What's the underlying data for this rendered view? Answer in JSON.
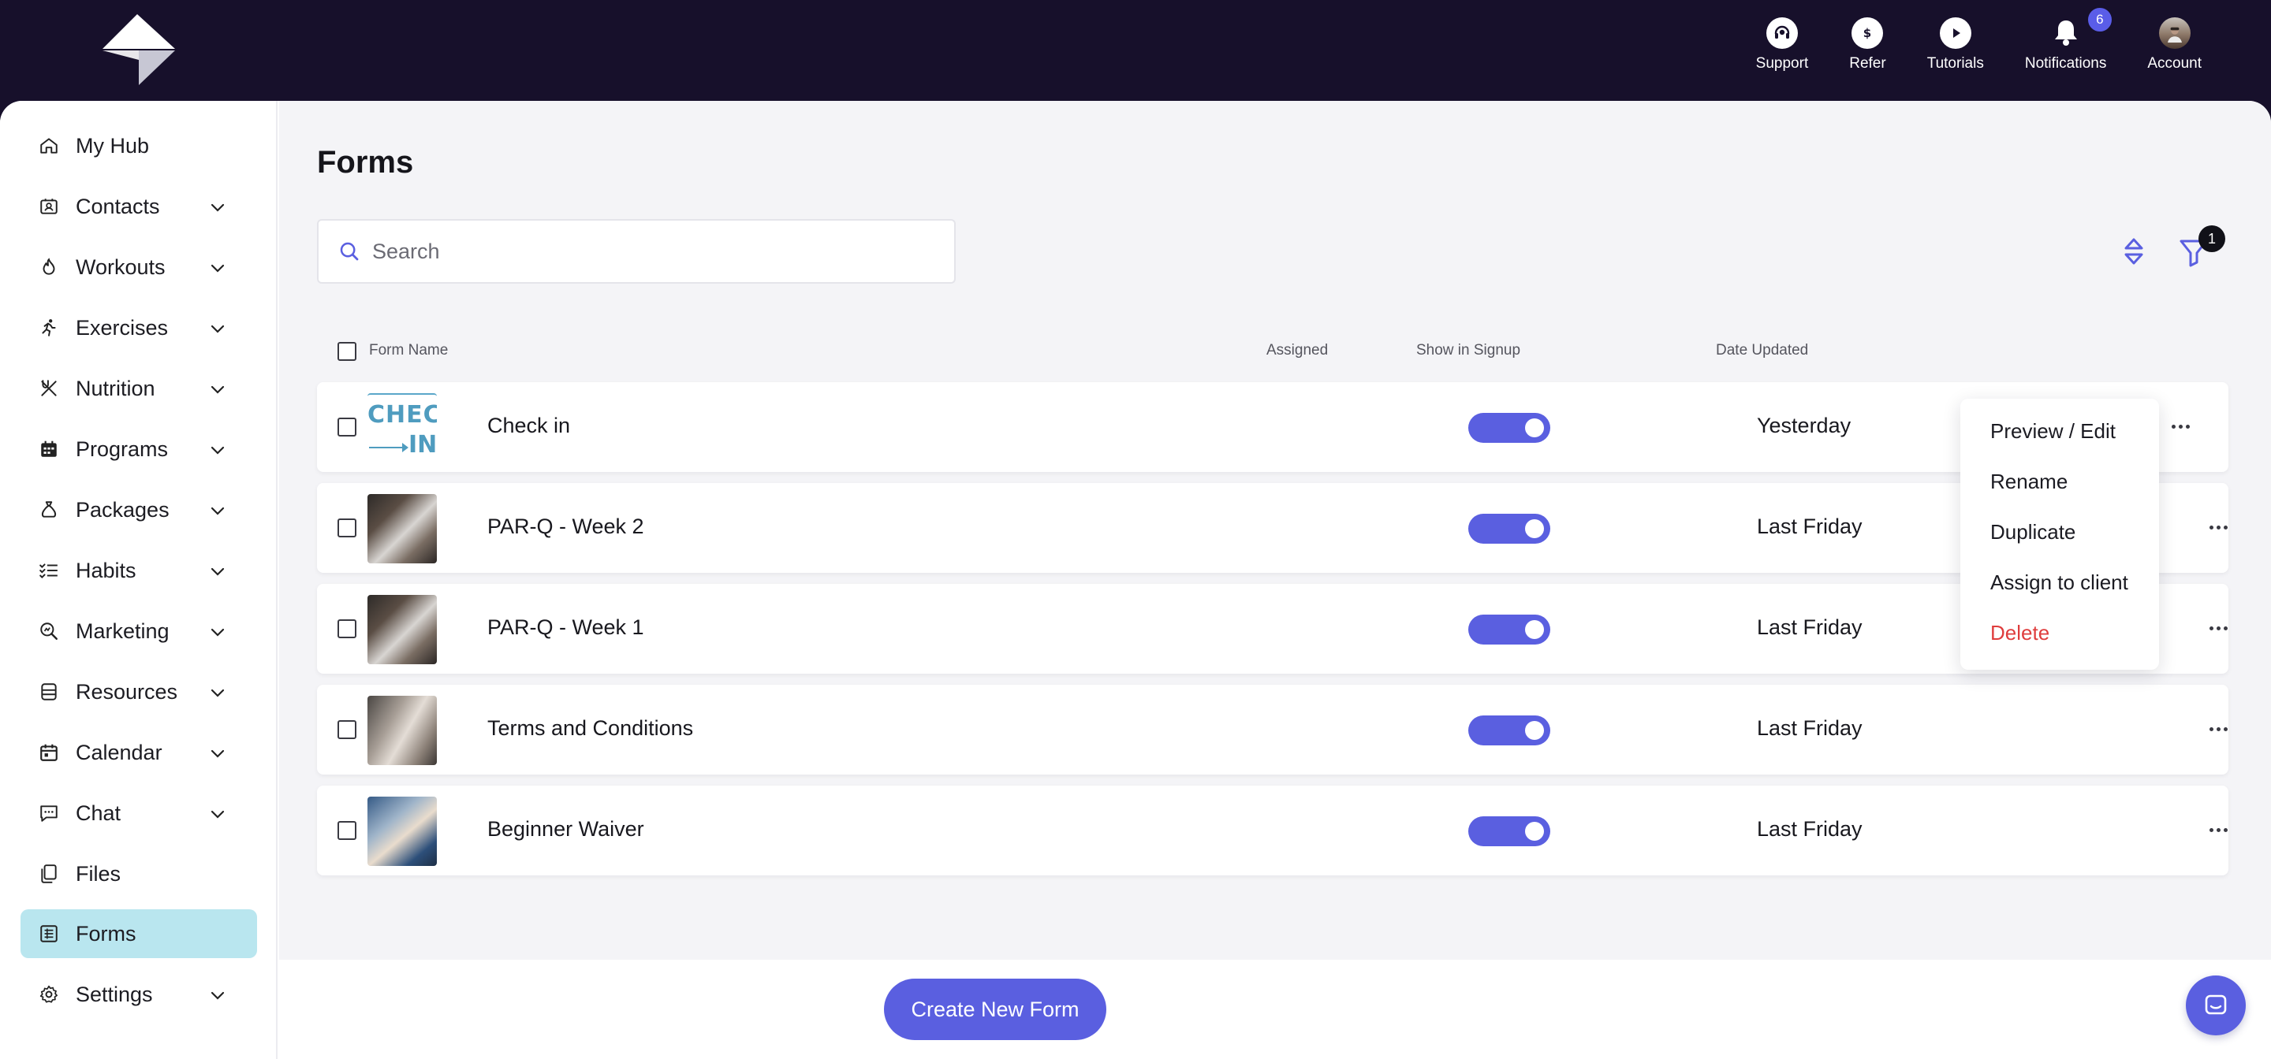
{
  "topnav": {
    "support": "Support",
    "refer": "Refer",
    "tutorials": "Tutorials",
    "notifications": "Notifications",
    "notifications_count": "6",
    "account": "Account"
  },
  "sidebar": {
    "items": [
      {
        "label": "My Hub",
        "icon": "home-icon",
        "expandable": false
      },
      {
        "label": "Contacts",
        "icon": "contacts-icon",
        "expandable": true
      },
      {
        "label": "Workouts",
        "icon": "workouts-icon",
        "expandable": true
      },
      {
        "label": "Exercises",
        "icon": "exercises-icon",
        "expandable": true
      },
      {
        "label": "Nutrition",
        "icon": "nutrition-icon",
        "expandable": true
      },
      {
        "label": "Programs",
        "icon": "programs-icon",
        "expandable": true
      },
      {
        "label": "Packages",
        "icon": "packages-icon",
        "expandable": true
      },
      {
        "label": "Habits",
        "icon": "habits-icon",
        "expandable": true
      },
      {
        "label": "Marketing",
        "icon": "marketing-icon",
        "expandable": true
      },
      {
        "label": "Resources",
        "icon": "resources-icon",
        "expandable": true
      },
      {
        "label": "Calendar",
        "icon": "calendar-icon",
        "expandable": true
      },
      {
        "label": "Chat",
        "icon": "chat-icon",
        "expandable": true
      },
      {
        "label": "Files",
        "icon": "files-icon",
        "expandable": false
      },
      {
        "label": "Forms",
        "icon": "forms-icon",
        "expandable": false,
        "active": true
      },
      {
        "label": "Settings",
        "icon": "settings-icon",
        "expandable": true
      }
    ]
  },
  "page": {
    "title": "Forms",
    "search_placeholder": "Search",
    "filter_count": "1"
  },
  "table": {
    "columns": {
      "name": "Form Name",
      "assigned": "Assigned",
      "signup": "Show in Signup",
      "date": "Date Updated"
    },
    "rows": [
      {
        "name": "Check in",
        "date": "Yesterday",
        "show_in_signup": true,
        "thumb": "check-in-graphic"
      },
      {
        "name": "PAR-Q - Week 2",
        "date": "Last Friday",
        "show_in_signup": true,
        "thumb": "trainer-photo"
      },
      {
        "name": "PAR-Q - Week 1",
        "date": "Last Friday",
        "show_in_signup": true,
        "thumb": "trainer-photo"
      },
      {
        "name": "Terms and Conditions",
        "date": "Last Friday",
        "show_in_signup": true,
        "thumb": "gym-photo"
      },
      {
        "name": "Beginner Waiver",
        "date": "Last Friday",
        "show_in_signup": true,
        "thumb": "coach-photo"
      }
    ]
  },
  "thumb_text": {
    "check": "CHECK",
    "in": "IN"
  },
  "menu": {
    "preview": "Preview / Edit",
    "rename": "Rename",
    "duplicate": "Duplicate",
    "assign": "Assign to client",
    "delete": "Delete"
  },
  "footer": {
    "create_label": "Create New Form"
  },
  "colors": {
    "accent": "#5a5fe0",
    "topbar": "#17102b",
    "active_nav": "#b9e6ef",
    "danger": "#df3d3d"
  }
}
